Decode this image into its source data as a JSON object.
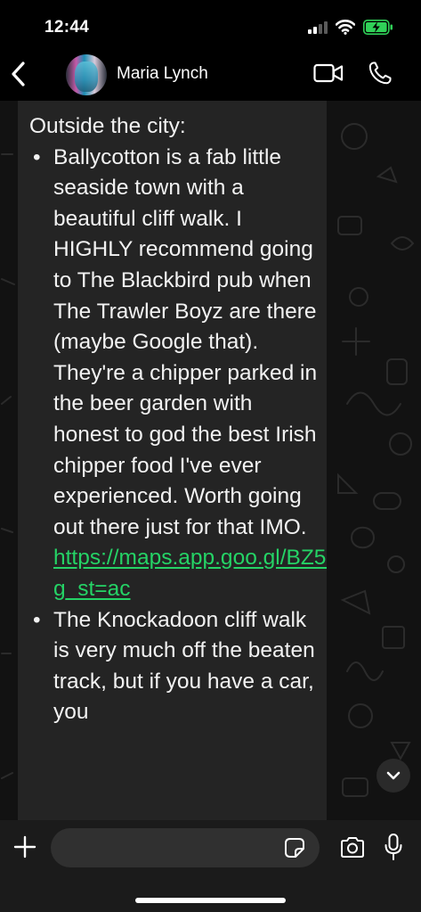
{
  "status_bar": {
    "time": "12:44",
    "battery_color": "#30d158"
  },
  "header": {
    "contact_name": "Maria Lynch",
    "back_icon": "chevron-left-icon",
    "video_icon": "video-camera-icon",
    "call_icon": "phone-icon"
  },
  "message": {
    "heading": "Outside the city:",
    "items": [
      {
        "text": "Ballycotton is a fab little seaside town with a beautiful cliff walk. I HIGHLY recommend going to The Blackbird pub when The Trawler Boyz are there (maybe Google that). They're a chipper parked in the beer garden with honest to god the best Irish chipper food I've ever experienced. Worth going out there just for that IMO. ",
        "link": "https://maps.app.goo.gl/BZ5n1bnZBhsKdxjh7?g_st=ac"
      },
      {
        "text": "The Knockadoon cliff walk is very much off the beaten track, but if you have a car, you"
      }
    ],
    "link_color": "#25d366"
  },
  "scroll_down_icon": "chevron-down-icon",
  "input_bar": {
    "placeholder": "",
    "icons": [
      "plus-icon",
      "sticker-icon",
      "camera-icon",
      "microphone-icon"
    ]
  }
}
